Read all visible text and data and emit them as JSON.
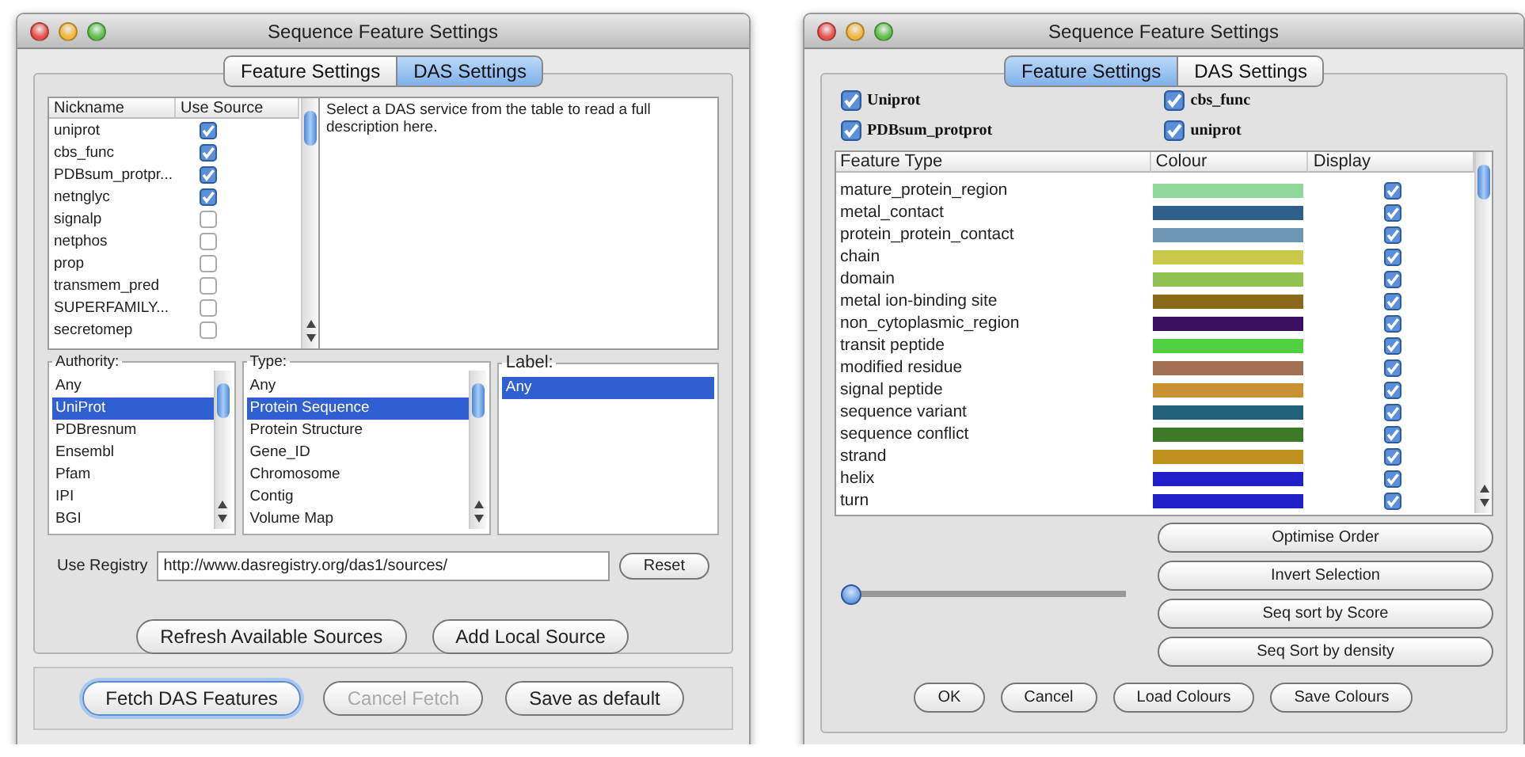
{
  "left_window": {
    "title": "Sequence Feature Settings",
    "tabs": [
      {
        "label": "Feature Settings",
        "selected": false
      },
      {
        "label": "DAS Settings",
        "selected": true
      }
    ],
    "sources_table": {
      "columns": [
        "Nickname",
        "Use Source"
      ],
      "rows": [
        {
          "nickname": "uniprot",
          "use_source": true
        },
        {
          "nickname": "cbs_func",
          "use_source": true
        },
        {
          "nickname": "PDBsum_protpr...",
          "use_source": true
        },
        {
          "nickname": "netnglyc",
          "use_source": true
        },
        {
          "nickname": "signalp",
          "use_source": false
        },
        {
          "nickname": "netphos",
          "use_source": false
        },
        {
          "nickname": "prop",
          "use_source": false
        },
        {
          "nickname": "transmem_pred",
          "use_source": false
        },
        {
          "nickname": "SUPERFAMILY...",
          "use_source": false
        },
        {
          "nickname": "secretomep",
          "use_source": false
        }
      ]
    },
    "description": "Select a DAS service from the table to read a full description here.",
    "filters": [
      {
        "label": "Authority:",
        "items": [
          {
            "text": "Any",
            "selected": false
          },
          {
            "text": "UniProt",
            "selected": true
          },
          {
            "text": "PDBresnum",
            "selected": false
          },
          {
            "text": "Ensembl",
            "selected": false
          },
          {
            "text": "Pfam",
            "selected": false
          },
          {
            "text": "IPI",
            "selected": false
          },
          {
            "text": "BGI",
            "selected": false
          }
        ]
      },
      {
        "label": "Type:",
        "items": [
          {
            "text": "Any",
            "selected": false
          },
          {
            "text": "Protein Sequence",
            "selected": true
          },
          {
            "text": "Protein Structure",
            "selected": false
          },
          {
            "text": "Gene_ID",
            "selected": false
          },
          {
            "text": "Chromosome",
            "selected": false
          },
          {
            "text": "Contig",
            "selected": false
          },
          {
            "text": "Volume Map",
            "selected": false
          }
        ]
      },
      {
        "label": "Label:",
        "items": [
          {
            "text": "Any",
            "selected": true
          }
        ]
      }
    ],
    "registry": {
      "label": "Use Registry",
      "value": "http://www.dasregistry.org/das1/sources/",
      "reset_button": "Reset"
    },
    "source_buttons": [
      "Refresh Available Sources",
      "Add Local Source"
    ],
    "action_buttons": [
      {
        "label": "Fetch DAS Features",
        "default": true,
        "disabled": false
      },
      {
        "label": "Cancel Fetch",
        "default": false,
        "disabled": true
      },
      {
        "label": "Save as default",
        "default": false,
        "disabled": false
      }
    ]
  },
  "right_window": {
    "title": "Sequence Feature Settings",
    "tabs": [
      {
        "label": "Feature Settings",
        "selected": true
      },
      {
        "label": "DAS Settings",
        "selected": false
      }
    ],
    "sources": [
      {
        "label": "Uniprot",
        "checked": true
      },
      {
        "label": "cbs_func",
        "checked": true
      },
      {
        "label": "PDBsum_protprot",
        "checked": true
      },
      {
        "label": "uniprot",
        "checked": true
      }
    ],
    "feature_table": {
      "columns": [
        "Feature Type",
        "Colour",
        "Display"
      ],
      "rows": [
        {
          "type": "mature_protein_region",
          "color": "#8fd99a",
          "display": true
        },
        {
          "type": "metal_contact",
          "color": "#2f5f8a",
          "display": true
        },
        {
          "type": "protein_protein_contact",
          "color": "#6a96b4",
          "display": true
        },
        {
          "type": "chain",
          "color": "#c8c84a",
          "display": true
        },
        {
          "type": "domain",
          "color": "#8fc050",
          "display": true
        },
        {
          "type": "metal ion-binding site",
          "color": "#8a6a18",
          "display": true
        },
        {
          "type": "non_cytoplasmic_region",
          "color": "#3c1060",
          "display": true
        },
        {
          "type": "transit peptide",
          "color": "#50d040",
          "display": true
        },
        {
          "type": "modified residue",
          "color": "#a07050",
          "display": true
        },
        {
          "type": "signal peptide",
          "color": "#c89030",
          "display": true
        },
        {
          "type": "sequence variant",
          "color": "#20607a",
          "display": true
        },
        {
          "type": "sequence conflict",
          "color": "#3c7a28",
          "display": true
        },
        {
          "type": "strand",
          "color": "#c09020",
          "display": true
        },
        {
          "type": "helix",
          "color": "#2020c8",
          "display": true
        },
        {
          "type": "turn",
          "color": "#2020c8",
          "display": true
        }
      ]
    },
    "transparency_slider": {
      "level": 0
    },
    "side_buttons": [
      "Optimise Order",
      "Invert Selection",
      "Seq sort by Score",
      "Seq Sort by density"
    ],
    "dialog_buttons": [
      "OK",
      "Cancel",
      "Load Colours",
      "Save Colours"
    ]
  }
}
